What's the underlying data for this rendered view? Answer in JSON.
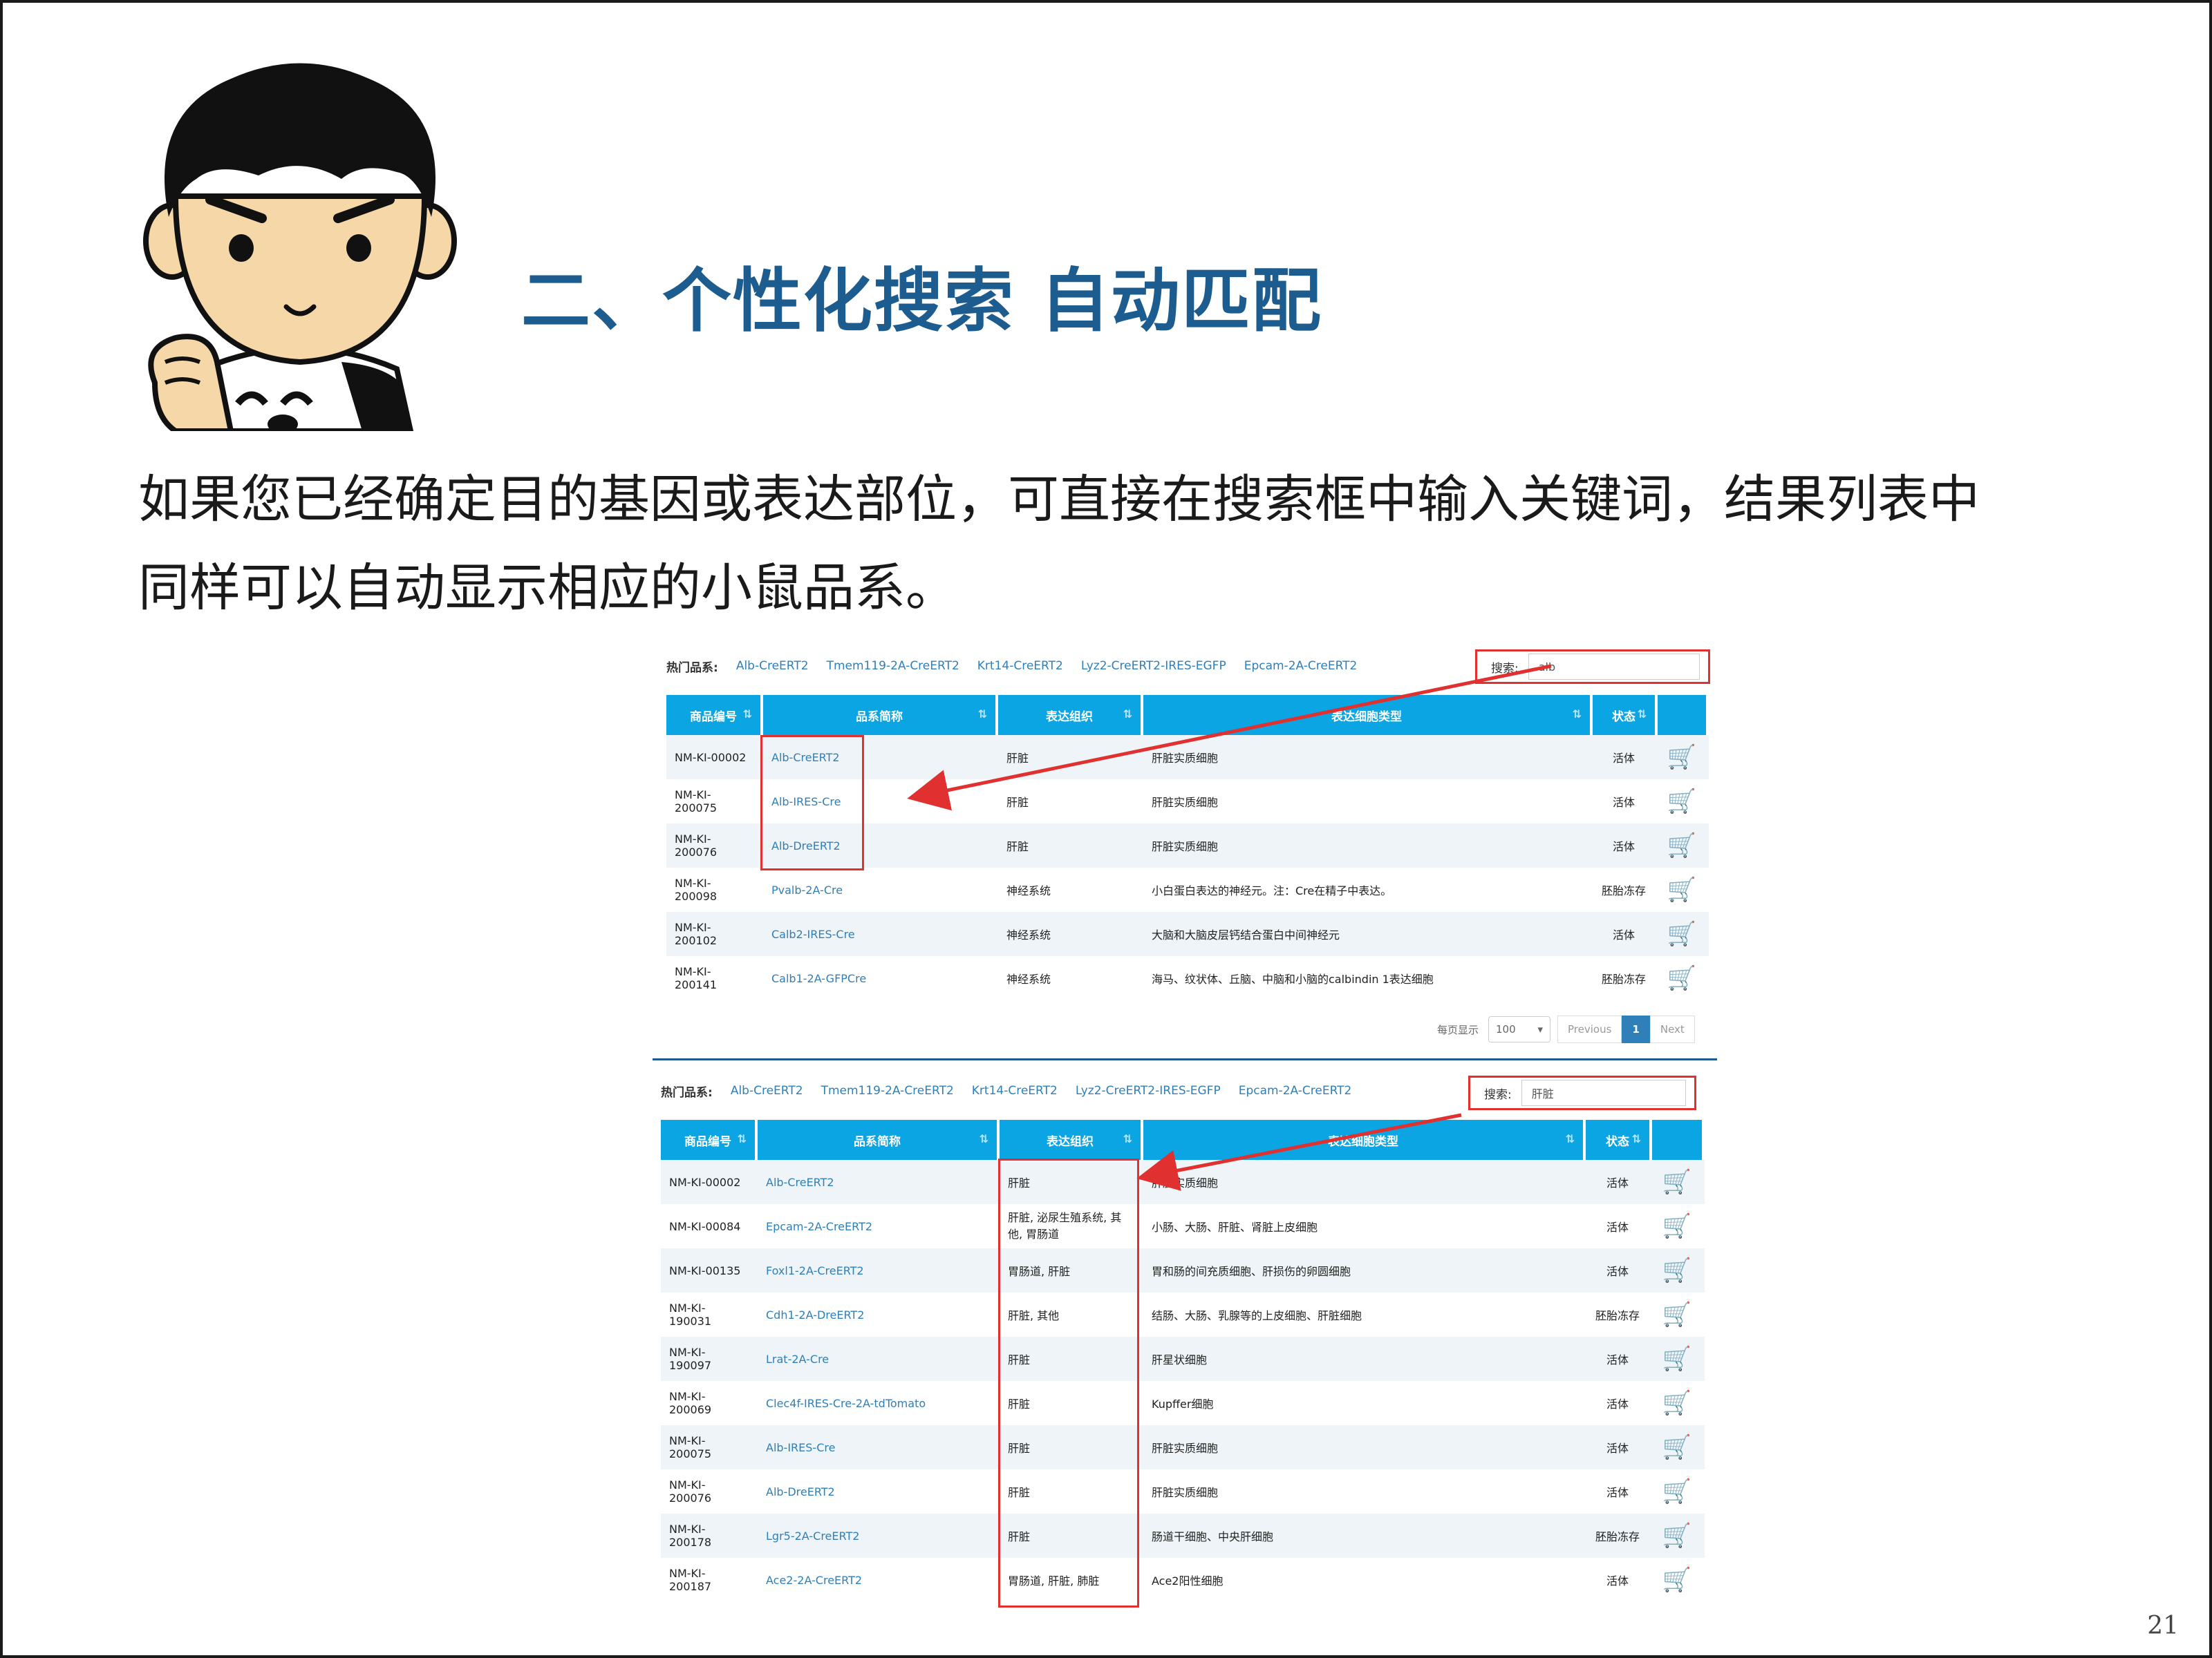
{
  "slide": {
    "title": "二、个性化搜索 自动匹配",
    "body_line1": "如果您已经确定目的基因或表达部位，可直接在搜索框中输入关键词，结果列表中",
    "body_line2": "同样可以自动显示相应的小鼠品系。",
    "page_number": "21"
  },
  "screenshot1": {
    "hot_label": "热门品系:",
    "hot_links": [
      "Alb-CreERT2",
      "Tmem119-2A-CreERT2",
      "Krt14-CreERT2",
      "Lyz2-CreERT2-IRES-EGFP",
      "Epcam-2A-CreERT2"
    ],
    "search_label": "搜索:",
    "search_value": "alb",
    "headers": [
      "商品编号",
      "品系简称",
      "表达组织",
      "表达细胞类型",
      "状态",
      ""
    ],
    "rows": [
      {
        "id": "NM-KI-00002",
        "strain": "Alb-CreERT2",
        "tissue": "肝脏",
        "cell": "肝脏实质细胞",
        "state": "活体"
      },
      {
        "id": "NM-KI-200075",
        "strain": "Alb-IRES-Cre",
        "tissue": "肝脏",
        "cell": "肝脏实质细胞",
        "state": "活体"
      },
      {
        "id": "NM-KI-200076",
        "strain": "Alb-DreERT2",
        "tissue": "肝脏",
        "cell": "肝脏实质细胞",
        "state": "活体"
      },
      {
        "id": "NM-KI-200098",
        "strain": "Pvalb-2A-Cre",
        "tissue": "神经系统",
        "cell": "小白蛋白表达的神经元。注：Cre在精子中表达。",
        "state": "胚胎冻存"
      },
      {
        "id": "NM-KI-200102",
        "strain": "Calb2-IRES-Cre",
        "tissue": "神经系统",
        "cell": "大脑和大脑皮层钙结合蛋白中间神经元",
        "state": "活体"
      },
      {
        "id": "NM-KI-200141",
        "strain": "Calb1-2A-GFPCre",
        "tissue": "神经系统",
        "cell": "海马、纹状体、丘脑、中脑和小脑的calbindin 1表达细胞",
        "state": "胚胎冻存"
      }
    ],
    "pager": {
      "label": "每页显示",
      "page_size": "100",
      "prev": "Previous",
      "current": "1",
      "next": "Next"
    }
  },
  "screenshot2": {
    "hot_label": "热门品系:",
    "hot_links": [
      "Alb-CreERT2",
      "Tmem119-2A-CreERT2",
      "Krt14-CreERT2",
      "Lyz2-CreERT2-IRES-EGFP",
      "Epcam-2A-CreERT2"
    ],
    "search_label": "搜索:",
    "search_value": "肝脏",
    "headers": [
      "商品编号",
      "品系简称",
      "表达组织",
      "表达细胞类型",
      "状态",
      ""
    ],
    "rows": [
      {
        "id": "NM-KI-00002",
        "strain": "Alb-CreERT2",
        "tissue": "肝脏",
        "cell": "肝脏实质细胞",
        "state": "活体"
      },
      {
        "id": "NM-KI-00084",
        "strain": "Epcam-2A-CreERT2",
        "tissue": "肝脏, 泌尿生殖系统, 其他, 胃肠道",
        "cell": "小肠、大肠、肝脏、肾脏上皮细胞",
        "state": "活体"
      },
      {
        "id": "NM-KI-00135",
        "strain": "Foxl1-2A-CreERT2",
        "tissue": "胃肠道, 肝脏",
        "cell": "胃和肠的间充质细胞、肝损伤的卵圆细胞",
        "state": "活体"
      },
      {
        "id": "NM-KI-190031",
        "strain": "Cdh1-2A-DreERT2",
        "tissue": "肝脏, 其他",
        "cell": "结肠、大肠、乳腺等的上皮细胞、肝脏细胞",
        "state": "胚胎冻存"
      },
      {
        "id": "NM-KI-190097",
        "strain": "Lrat-2A-Cre",
        "tissue": "肝脏",
        "cell": "肝星状细胞",
        "state": "活体"
      },
      {
        "id": "NM-KI-200069",
        "strain": "Clec4f-IRES-Cre-2A-tdTomato",
        "tissue": "肝脏",
        "cell": "Kupffer细胞",
        "state": "活体"
      },
      {
        "id": "NM-KI-200075",
        "strain": "Alb-IRES-Cre",
        "tissue": "肝脏",
        "cell": "肝脏实质细胞",
        "state": "活体"
      },
      {
        "id": "NM-KI-200076",
        "strain": "Alb-DreERT2",
        "tissue": "肝脏",
        "cell": "肝脏实质细胞",
        "state": "活体"
      },
      {
        "id": "NM-KI-200178",
        "strain": "Lgr5-2A-CreERT2",
        "tissue": "肝脏",
        "cell": "肠道干细胞、中央肝细胞",
        "state": "胚胎冻存"
      },
      {
        "id": "NM-KI-200187",
        "strain": "Ace2-2A-CreERT2",
        "tissue": "胃肠道, 肝脏, 肺脏",
        "cell": "Ace2阳性细胞",
        "state": "活体"
      }
    ]
  },
  "colors": {
    "title": "#1c5c8e",
    "header_bg": "#0aa5e2",
    "link": "#2f7fb8",
    "highlight": "#e03030",
    "cart": "#f08c1e"
  },
  "icons": [
    "cart-icon",
    "sort-icon",
    "chevron-down-icon",
    "arrow-annotation"
  ]
}
